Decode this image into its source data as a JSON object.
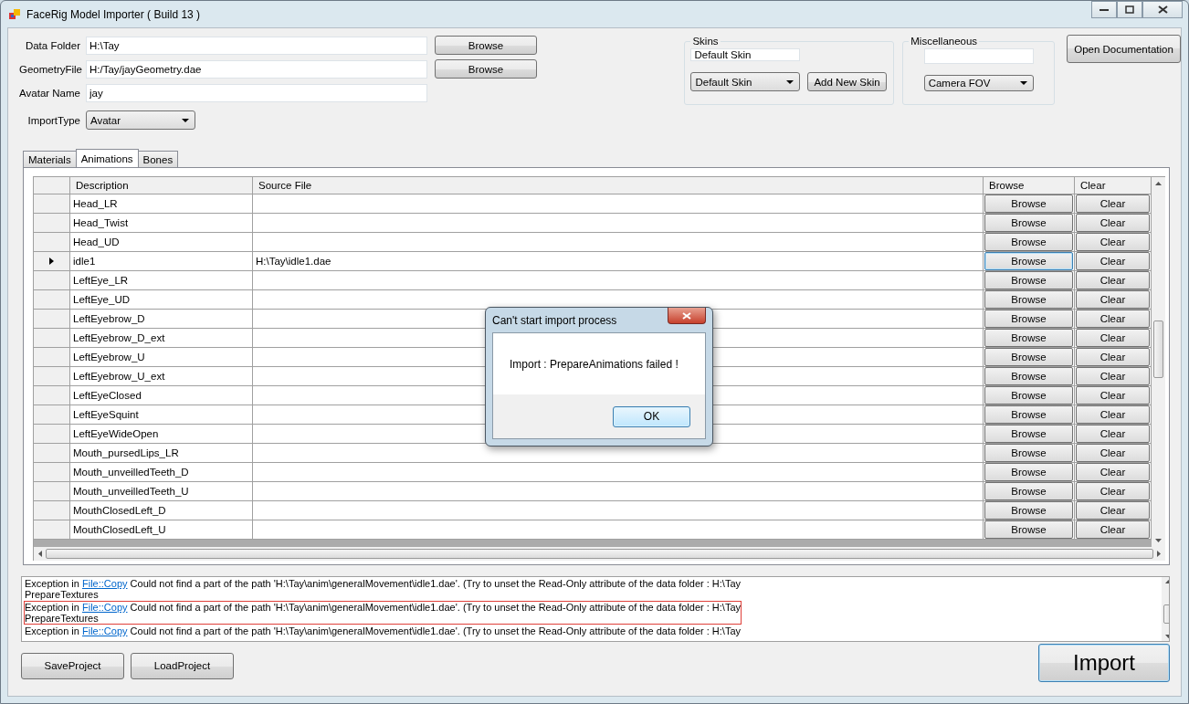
{
  "window": {
    "title": "FaceRig Model Importer ( Build 13 )"
  },
  "fields": [
    {
      "label": "Data Folder",
      "value": "H:\\Tay",
      "button": "Browse"
    },
    {
      "label": "GeometryFile",
      "value": "H:/Tay/jayGeometry.dae",
      "button": "Browse"
    },
    {
      "label": "Avatar Name",
      "value": "jay"
    }
  ],
  "import_type": {
    "label": "ImportType",
    "value": "Avatar"
  },
  "skins": {
    "title": "Skins",
    "name_value": "Default Skin",
    "dropdown": "Default Skin",
    "button": "Add New Skin"
  },
  "miscellaneous": {
    "title": "Miscellaneous",
    "dropdown": "Camera FOV"
  },
  "open_documentation": "Open Documentation",
  "tabs": [
    {
      "label": "Materials",
      "selected": false
    },
    {
      "label": "Animations",
      "selected": true
    },
    {
      "label": "Bones",
      "selected": false
    }
  ],
  "table": {
    "columns": [
      "Description",
      "Source File",
      "Browse",
      "Clear"
    ],
    "rows": [
      {
        "description": "Head_LR",
        "browse": "Browse",
        "clear": "Clear",
        "selected": false
      },
      {
        "description": "Head_Twist",
        "browse": "Browse",
        "clear": "Clear",
        "selected": false
      },
      {
        "description": "Head_UD",
        "browse": "Browse",
        "clear": "Clear",
        "selected": false
      },
      {
        "description": "idle1",
        "source_file": "H:\\Tay\\idle1.dae",
        "browse": "Browse",
        "clear": "Clear",
        "selected": true
      },
      {
        "description": "LeftEye_LR",
        "browse": "Browse",
        "clear": "Clear",
        "selected": false
      },
      {
        "description": "LeftEye_UD",
        "browse": "Browse",
        "clear": "Clear",
        "selected": false
      },
      {
        "description": "LeftEyebrow_D",
        "browse": "Browse",
        "clear": "Clear",
        "selected": false
      },
      {
        "description": "LeftEyebrow_D_ext",
        "browse": "Browse",
        "clear": "Clear",
        "selected": false
      },
      {
        "description": "LeftEyebrow_U",
        "browse": "Browse",
        "clear": "Clear",
        "selected": false
      },
      {
        "description": "LeftEyebrow_U_ext",
        "browse": "Browse",
        "clear": "Clear",
        "selected": false
      },
      {
        "description": "LeftEyeClosed",
        "browse": "Browse",
        "clear": "Clear",
        "selected": false
      },
      {
        "description": "LeftEyeSquint",
        "browse": "Browse",
        "clear": "Clear",
        "selected": false
      },
      {
        "description": "LeftEyeWideOpen",
        "browse": "Browse",
        "clear": "Clear",
        "selected": false
      },
      {
        "description": "Mouth_pursedLips_LR",
        "browse": "Browse",
        "clear": "Clear",
        "selected": false
      },
      {
        "description": "Mouth_unveilledTeeth_D",
        "browse": "Browse",
        "clear": "Clear",
        "selected": false
      },
      {
        "description": "Mouth_unveilledTeeth_U",
        "browse": "Browse",
        "clear": "Clear",
        "selected": false
      },
      {
        "description": "MouthClosedLeft_D",
        "browse": "Browse",
        "clear": "Clear",
        "selected": false
      },
      {
        "description": "MouthClosedLeft_U",
        "browse": "Browse",
        "clear": "Clear",
        "selected": false
      }
    ]
  },
  "log": {
    "entries": [
      {
        "prefix": "Exception in",
        "link": "File::Copy",
        "message": "Could not find a part of the path 'H:\\Tay\\anim\\generalMovement\\idle1.dae'. (Try to unset the Read-Only attribute of the data folder : H:\\Tay",
        "detail": "PrepareTextures",
        "selected": false
      },
      {
        "prefix": "Exception in",
        "link": "File::Copy",
        "message": "Could not find a part of the path 'H:\\Tay\\anim\\generalMovement\\idle1.dae'. (Try to unset the Read-Only attribute of the data folder : H:\\Tay",
        "detail": "PrepareTextures",
        "selected": true
      },
      {
        "prefix": "Exception in",
        "link": "File::Copy",
        "message": "Could not find a part of the path 'H:\\Tay\\anim\\generalMovement\\idle1.dae'. (Try to unset the Read-Only attribute of the data folder : H:\\Tay",
        "selected": false
      }
    ]
  },
  "buttons": {
    "save": "SaveProject",
    "load": "LoadProject",
    "import": "Import"
  },
  "dialog": {
    "title": "Can't start import process",
    "message": "Import : PrepareAnimations failed !",
    "button": "OK"
  }
}
